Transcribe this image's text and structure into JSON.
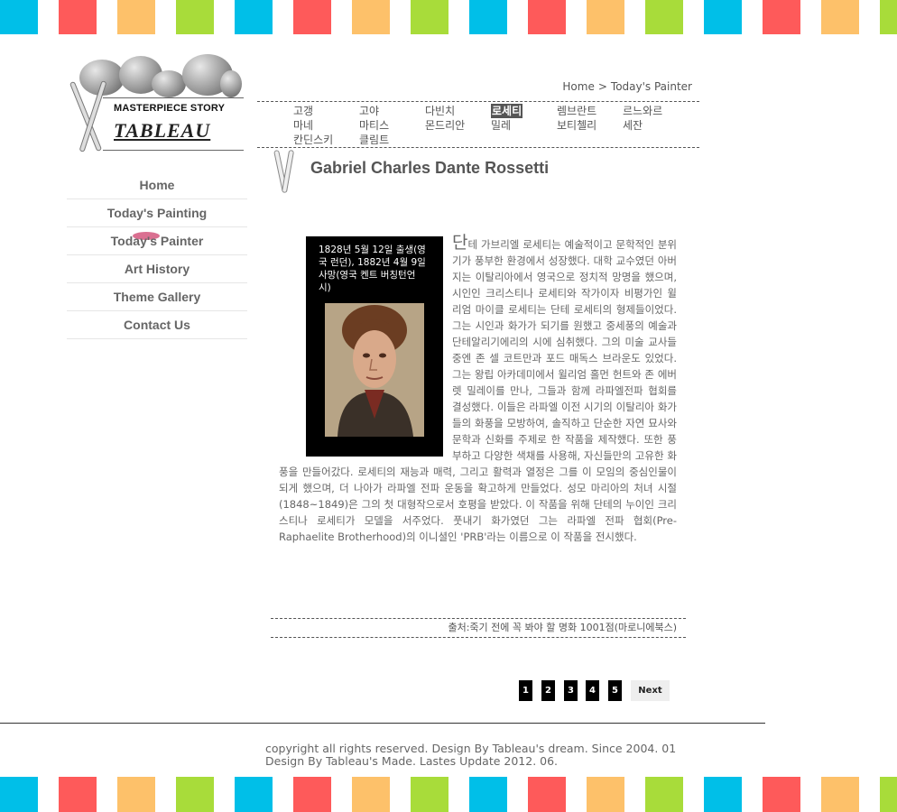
{
  "stripe_colors": [
    "#00bfe8",
    "#fe5a5a",
    "#fdc16a",
    "#a8dc3a"
  ],
  "logo": {
    "line1": "MASTERPIECE STORY",
    "line2": "TABLEAU"
  },
  "nav": [
    {
      "label": "Home",
      "icon": "none"
    },
    {
      "label": "Today's Painting",
      "icon": "none"
    },
    {
      "label": "Today's Painter",
      "icon": "pink-highlight",
      "active": true
    },
    {
      "label": "Art History",
      "icon": "none"
    },
    {
      "label": "Theme Gallery",
      "icon": "none"
    },
    {
      "label": "Contact Us",
      "icon": "none"
    }
  ],
  "breadcrumb": {
    "home": "Home",
    "separator": ">",
    "current": "Today's Painter"
  },
  "painters": [
    [
      "고갱",
      "고야",
      "다빈치",
      "로세티",
      "렘브란트",
      "르느와르"
    ],
    [
      "마네",
      "마티스",
      "몬드리안",
      "밀레",
      "보티첼리",
      "세잔"
    ],
    [
      "칸딘스키",
      "클림트"
    ]
  ],
  "selected_painter": "로세티",
  "title": "Gabriel Charles Dante Rossetti",
  "figure": {
    "caption": "1828년 5월 12일 출생(영국 런던), 1882년 4월 9일 사망(영국 켄트 버칭턴언 시)",
    "image": "portrait-of-rossetti"
  },
  "article": {
    "dropcap": "단",
    "body": "테 가브리엘 로세티는 예술적이고 문학적인 분위기가 풍부한 환경에서 성장했다. 대학 교수였던 아버지는 이탈리아에서 영국으로 정치적 망명을 했으며, 시인인 크리스티나 로세티와 작가이자 비평가인 윌리엄 마이클 로세티는 단테 로세티의 형제들이었다. 그는 시인과 화가가 되기를 원했고 중세풍의 예술과 단테알리기에리의 시에 심취했다. 그의 미술 교사들 중엔 존 셀 코트만과 포드 매독스 브라운도 있었다. 그는 왕립 아카데미에서 윌리엄 홀먼 헌트와 존 에버렛 밀레이를 만나, 그들과 함께 라파엘전파 협회를 결성했다. 이들은 라파엘 이전 시기의 이탈리아 화가들의 화풍을 모방하여, 솔직하고 단순한 자연 묘사와 문학과 신화를 주제로 한 작품을 제작했다. 또한 풍부하고 다양한 색채를 사용해, 자신들만의 고유한 화풍을 만들어갔다. 로세티의 재능과 매력, 그리고 활력과 열정은 그를 이 모임의 중심인물이 되게 했으며, 더 나아가 라파엘 전파 운동을 확고하게 만들었다. 성모 마리아의 처녀 시절(1848~1849)은 그의 첫 대형작으로서 호평을 받았다. 이 작품을 위해 단테의 누이인 크리스티나 로세티가 모델을 서주었다. 풋내기 화가였던 그는 라파엘 전파 협회(Pre-Raphaelite Brotherhood)의 이니셜인 'PRB'라는 이름으로 이 작품을 전시했다."
  },
  "source": "출처:죽기 전에 꼭 봐야 할 명화 1001점(마로니에북스)",
  "pagination": {
    "pages": [
      "1",
      "2",
      "3",
      "4",
      "5"
    ],
    "next": "Next"
  },
  "footer": {
    "line1": "copyright all rights reserved. Design By Tableau's dream. Since 2004. 01",
    "line2": "Design By Tableau's Made. Lastes Update 2012. 06."
  }
}
